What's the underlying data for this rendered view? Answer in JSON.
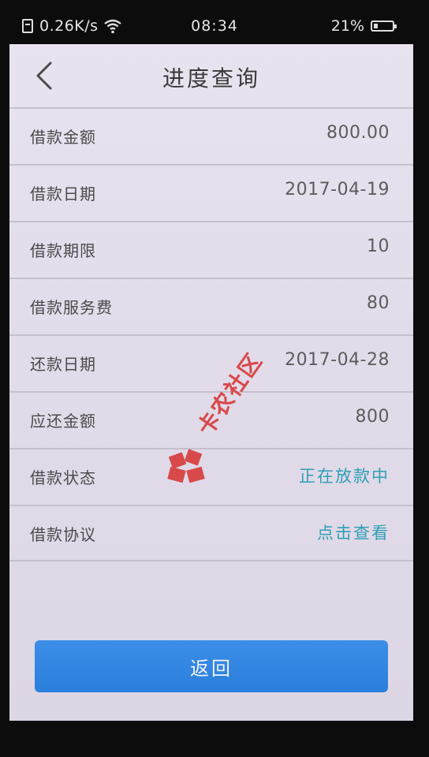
{
  "status_bar": {
    "net_speed": "0.26K/s",
    "time": "08:34",
    "battery": "21%"
  },
  "header": {
    "title": "进度查询"
  },
  "rows": [
    {
      "label": "借款金额",
      "value": "800.00"
    },
    {
      "label": "借款日期",
      "value": "2017-04-19"
    },
    {
      "label": "借款期限",
      "value": "10"
    },
    {
      "label": "借款服务费",
      "value": "80"
    },
    {
      "label": "还款日期",
      "value": "2017-04-28"
    },
    {
      "label": "应还金额",
      "value": "800"
    },
    {
      "label": "借款状态",
      "value": "正在放款中"
    },
    {
      "label": "借款协议",
      "value": "点击查看"
    }
  ],
  "footer": {
    "back_label": "返回"
  },
  "watermark": {
    "text": "卡农社区"
  },
  "colors": {
    "accent": "#2a7fdc",
    "link": "#2f9fb5",
    "watermark": "#d84a4a"
  }
}
